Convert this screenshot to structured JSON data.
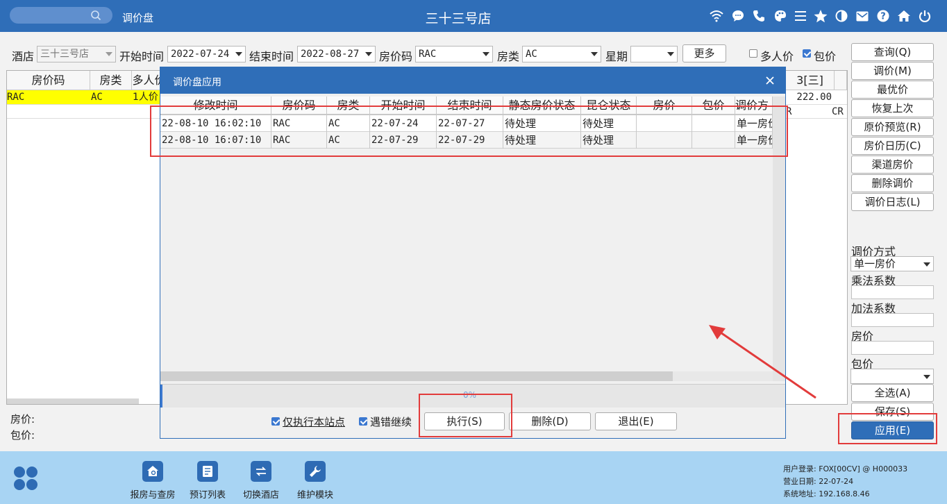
{
  "topbar": {
    "app_title": "调价盘",
    "store_title": "三十三号店",
    "icons": [
      "wifi-icon",
      "chat-icon",
      "phone-icon",
      "palette-icon",
      "menu-icon",
      "star-icon",
      "theme-icon",
      "mail-icon",
      "help-icon",
      "home-icon",
      "power-icon"
    ]
  },
  "filters": {
    "hotel_label": "酒店",
    "hotel_value": "三十三号店",
    "start_label": "开始时间",
    "start_value": "2022-07-24",
    "end_label": "结束时间",
    "end_value": "2022-08-27",
    "ratecode_label": "房价码",
    "ratecode_value": "RAC",
    "roomtype_label": "房类",
    "roomtype_value": "AC",
    "week_label": "星期",
    "week_value": "",
    "more_button": "更多",
    "multi_price_label": "多人价",
    "multi_price_checked": false,
    "package_price_label": "包价",
    "package_price_checked": true
  },
  "main_grid": {
    "headers": [
      "房价码",
      "房类",
      "多人价"
    ],
    "right_header": "3[三]",
    "row1": {
      "ratecode": "RAC",
      "roomtype": "AC",
      "multi": "1人价",
      "right_value": "222.00"
    },
    "row2": {
      "right_left": "R",
      "right_value": "CR"
    }
  },
  "bottom_labels": {
    "room_price": "房价:",
    "package_price": "包价:"
  },
  "sidebar": {
    "buttons": [
      "查询(Q)",
      "调价(M)",
      "最优价",
      "恢复上次",
      "原价预览(R)",
      "房价日历(C)",
      "渠道房价",
      "删除调价",
      "调价日志(L)"
    ],
    "method_label": "调价方式",
    "method_value": "单一房价",
    "multiplier_label": "乘法系数",
    "adder_label": "加法系数",
    "price_label": "房价",
    "package_label": "包价",
    "select_all": "全选(A)",
    "save": "保存(S)",
    "apply": "应用(E)"
  },
  "modal": {
    "title": "调价盘应用",
    "columns": [
      "修改时间",
      "房价码",
      "房类",
      "开始时间",
      "结束时间",
      "静态房价状态",
      "昆仑状态",
      "房价",
      "包价",
      "调价方"
    ],
    "rows": [
      {
        "modified": "22-08-10 16:02:10",
        "ratecode": "RAC",
        "roomtype": "AC",
        "start": "22-07-24",
        "end": "22-07-27",
        "static_status": "待处理",
        "kunlun_status": "待处理",
        "price": "",
        "package": "",
        "method": "单一房价"
      },
      {
        "modified": "22-08-10 16:07:10",
        "ratecode": "RAC",
        "roomtype": "AC",
        "start": "22-07-29",
        "end": "22-07-29",
        "static_status": "待处理",
        "kunlun_status": "待处理",
        "price": "",
        "package": "",
        "method": "单一房价"
      }
    ],
    "progress": 0,
    "progress_text": "0%",
    "local_only_label": "仅执行本站点",
    "local_only_checked": true,
    "continue_on_error_label": "遇错继续",
    "continue_on_error_checked": true,
    "execute_button": "执行(S)",
    "delete_button": "删除(D)",
    "exit_button": "退出(E)"
  },
  "dock": {
    "items": [
      {
        "label": "报房与查房",
        "icon": "house-search-icon"
      },
      {
        "label": "预订列表",
        "icon": "document-list-icon"
      },
      {
        "label": "切换酒店",
        "icon": "switch-icon"
      },
      {
        "label": "维护模块",
        "icon": "wrench-icon"
      }
    ]
  },
  "status": {
    "user": "用户登录:  FOX[00CV] @ H000033",
    "business_date": "营业日期:  22-07-24",
    "system_address": "系统地址:  192.168.8.46"
  },
  "colors": {
    "brand": "#2f6eb8",
    "highlight_row": "#ffff00",
    "annotation": "#e23b3b",
    "primary_button": "#2f6eb8"
  }
}
